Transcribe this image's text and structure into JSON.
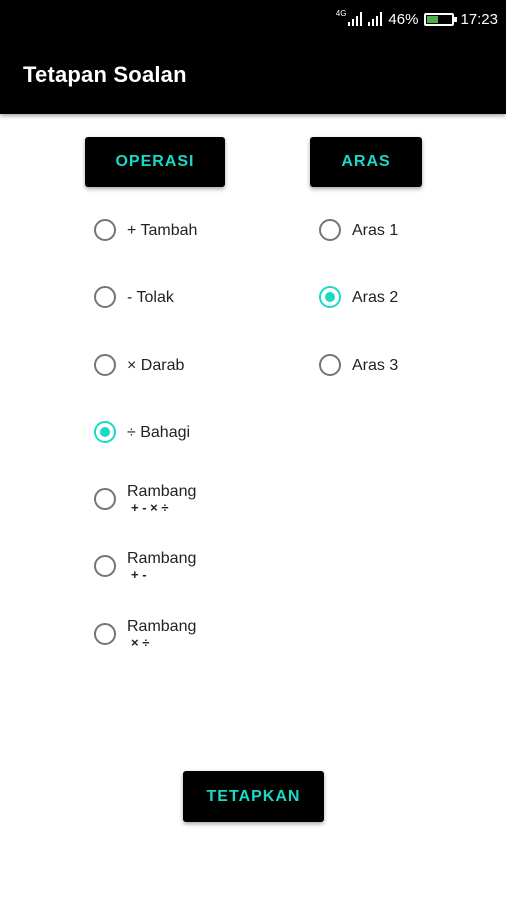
{
  "status_bar": {
    "network": "4G",
    "battery_percent": "46%",
    "battery_level": 0.46,
    "time": "17:23",
    "icons": [
      "signal-4g-icon",
      "signal-icon",
      "battery-icon"
    ]
  },
  "app_bar": {
    "title": "Tetapan Soalan"
  },
  "operation_group": {
    "header": "OPERASI",
    "options": [
      {
        "label": "+ Tambah",
        "sub": "",
        "checked": false
      },
      {
        "label": "- Tolak",
        "sub": "",
        "checked": false
      },
      {
        "label": "× Darab",
        "sub": "",
        "checked": false
      },
      {
        "label": "÷ Bahagi",
        "sub": "",
        "checked": true
      },
      {
        "label": "Rambang",
        "sub": "+ - × ÷",
        "checked": false
      },
      {
        "label": "Rambang",
        "sub": "+ -",
        "checked": false
      },
      {
        "label": "Rambang",
        "sub": "× ÷",
        "checked": false
      }
    ]
  },
  "level_group": {
    "header": "ARAS",
    "options": [
      {
        "label": "Aras 1",
        "checked": false
      },
      {
        "label": "Aras 2",
        "checked": true
      },
      {
        "label": "Aras 3",
        "checked": false
      }
    ]
  },
  "submit_button": {
    "label": "TETAPKAN"
  },
  "colors": {
    "accent": "#1ad9c6",
    "bar_background": "#000000",
    "radio_unchecked": "#757575"
  }
}
